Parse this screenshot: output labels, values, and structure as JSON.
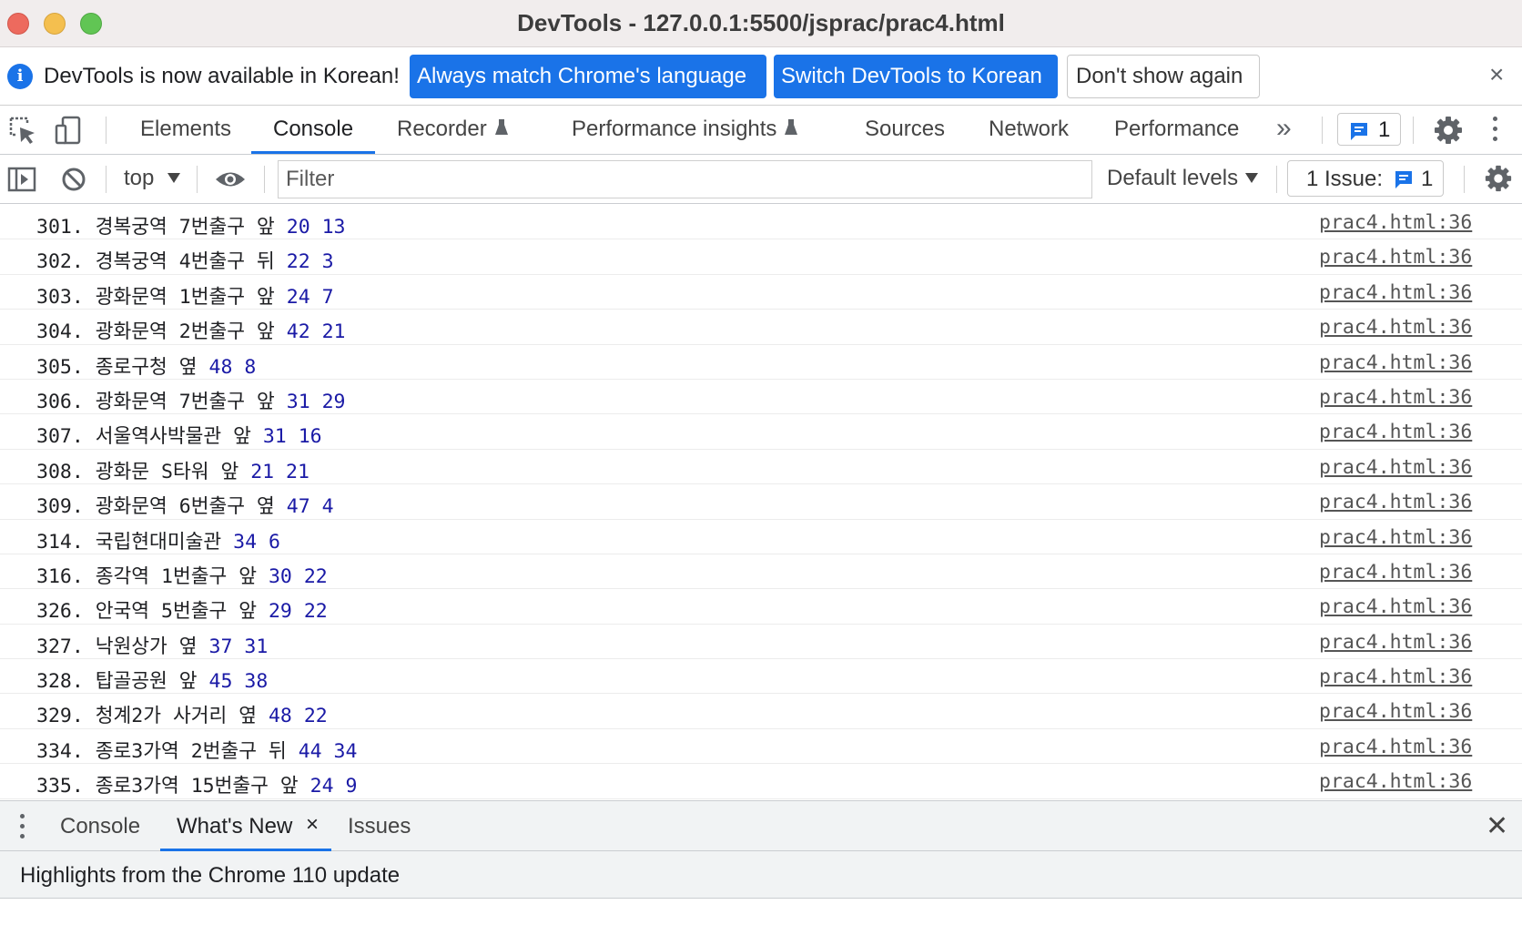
{
  "window": {
    "title": "DevTools - 127.0.0.1:5500/jsprac/prac4.html"
  },
  "infobar": {
    "message": "DevTools is now available in Korean!",
    "buttons": {
      "match_language": "Always match Chrome's language",
      "switch_korean": "Switch DevTools to Korean",
      "dont_show": "Don't show again"
    },
    "close": "×",
    "info_icon": "i"
  },
  "tabs": {
    "items": [
      "Elements",
      "Console",
      "Recorder",
      "Performance insights",
      "Sources",
      "Network",
      "Performance"
    ],
    "active": "Console",
    "more": "»",
    "issues_count": "1"
  },
  "console_toolbar": {
    "context": "top",
    "filter_placeholder": "Filter",
    "levels": "Default levels",
    "issues_label": "1 Issue:",
    "issues_count": "1"
  },
  "messages": [
    {
      "text": "301. 경복궁역 7번출구 앞",
      "n1": "20",
      "n2": "13",
      "source": "prac4.html:36"
    },
    {
      "text": "302. 경복궁역 4번출구 뒤",
      "n1": "22",
      "n2": "3",
      "source": "prac4.html:36"
    },
    {
      "text": "303. 광화문역 1번출구 앞",
      "n1": "24",
      "n2": "7",
      "source": "prac4.html:36"
    },
    {
      "text": "304. 광화문역 2번출구 앞",
      "n1": "42",
      "n2": "21",
      "source": "prac4.html:36"
    },
    {
      "text": "305. 종로구청 옆",
      "n1": "48",
      "n2": "8",
      "source": "prac4.html:36"
    },
    {
      "text": "306. 광화문역 7번출구 앞",
      "n1": "31",
      "n2": "29",
      "source": "prac4.html:36"
    },
    {
      "text": "307. 서울역사박물관 앞",
      "n1": "31",
      "n2": "16",
      "source": "prac4.html:36"
    },
    {
      "text": "308. 광화문 S타워 앞",
      "n1": "21",
      "n2": "21",
      "source": "prac4.html:36"
    },
    {
      "text": "309. 광화문역 6번출구 옆",
      "n1": "47",
      "n2": "4",
      "source": "prac4.html:36"
    },
    {
      "text": "314. 국립현대미술관",
      "n1": "34",
      "n2": "6",
      "source": "prac4.html:36"
    },
    {
      "text": "316. 종각역 1번출구 앞",
      "n1": "30",
      "n2": "22",
      "source": "prac4.html:36"
    },
    {
      "text": "326. 안국역 5번출구 앞",
      "n1": "29",
      "n2": "22",
      "source": "prac4.html:36"
    },
    {
      "text": "327. 낙원상가 옆",
      "n1": "37",
      "n2": "31",
      "source": "prac4.html:36"
    },
    {
      "text": "328. 탑골공원 앞",
      "n1": "45",
      "n2": "38",
      "source": "prac4.html:36"
    },
    {
      "text": "329. 청계2가 사거리 옆",
      "n1": "48",
      "n2": "22",
      "source": "prac4.html:36"
    },
    {
      "text": "334. 종로3가역 2번출구 뒤",
      "n1": "44",
      "n2": "34",
      "source": "prac4.html:36"
    },
    {
      "text": "335. 종로3가역 15번출구 앞",
      "n1": "24",
      "n2": "9",
      "source": "prac4.html:36"
    }
  ],
  "drawer": {
    "tabs": [
      "Console",
      "What's New",
      "Issues"
    ],
    "active": "What's New",
    "tab_close": "×",
    "close": "✕",
    "body_text": "Highlights from the Chrome 110 update"
  },
  "colors": {
    "accent": "#1a73e8",
    "console_number": "#1a1aa6",
    "traffic_red": "#ed6a5e",
    "traffic_yellow": "#f4bf4f",
    "traffic_green": "#61c554"
  },
  "icons": [
    "inspect-element-icon",
    "device-toolbar-icon",
    "flask-icon",
    "chat-icon",
    "gear-icon",
    "kebab-menu-icon",
    "sidebar-toggle-icon",
    "clear-console-icon",
    "eye-icon",
    "close-icon",
    "info-icon"
  ]
}
